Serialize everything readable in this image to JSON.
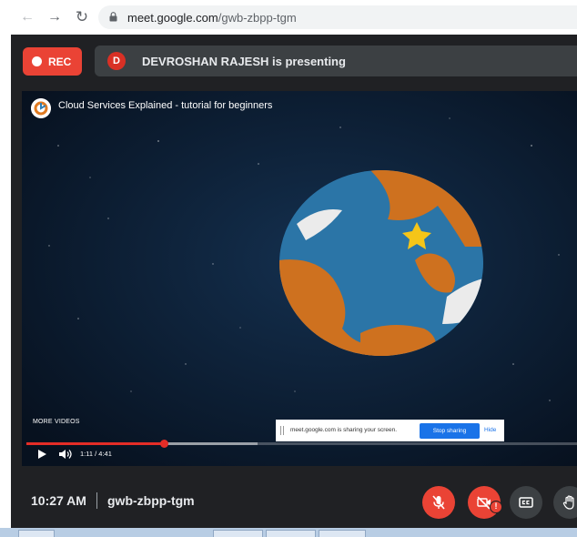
{
  "browser": {
    "url_host": "meet.google.com",
    "url_path": "/gwb-zbpp-tgm",
    "icons": [
      "back-arrow-icon",
      "forward-arrow-icon",
      "reload-icon",
      "lock-icon"
    ]
  },
  "meet": {
    "rec_label": "REC",
    "presenter_initial": "D",
    "presenting_text": "DEVROSHAN RAJESH is presenting",
    "time": "10:27 AM",
    "meeting_code": "gwb-zbpp-tgm",
    "controls": [
      "mic-off-icon",
      "camera-off-icon",
      "captions-icon",
      "raise-hand-icon"
    ],
    "camera_warning_badge": "!"
  },
  "video": {
    "title": "Cloud Services Explained - tutorial for beginners",
    "more_videos_label": "MORE VIDEOS",
    "current_time": "1:11",
    "duration": "4:41",
    "time_readout": "1:11 / 4:41",
    "played_fraction": 0.25,
    "buffered_fraction": 0.42
  },
  "share_banner": {
    "text": "meet.google.com is sharing your screen.",
    "stop_label": "Stop sharing",
    "hide_label": "Hide"
  },
  "colors": {
    "meet_background": "#202124",
    "record_red": "#ea4335",
    "progress_red": "#e52d27",
    "stop_button_blue": "#1a73e8",
    "globe_ocean": "#2f7fb6",
    "globe_land": "#e07b22"
  }
}
